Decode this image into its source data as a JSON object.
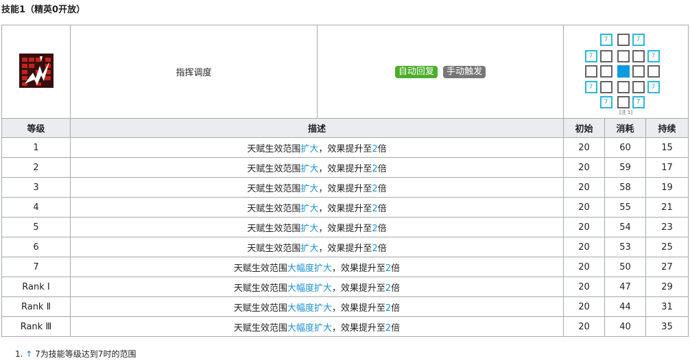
{
  "section_title": "技能1（精英0开放）",
  "skill": {
    "name": "指挥调度",
    "tags": [
      "自动回复",
      "手动触发"
    ],
    "range_note": "[注 1]",
    "range_ext_label": "7"
  },
  "columns": {
    "level": "等级",
    "desc": "描述",
    "init": "初始",
    "cost": "消耗",
    "duration": "持续"
  },
  "rows": [
    {
      "level": "1",
      "desc_a": "天赋生效范围",
      "desc_hl": "扩大",
      "desc_b": "，效果提升至",
      "desc_num": "2",
      "desc_c": "倍",
      "init": "20",
      "cost": "60",
      "duration": "15"
    },
    {
      "level": "2",
      "desc_a": "天赋生效范围",
      "desc_hl": "扩大",
      "desc_b": "，效果提升至",
      "desc_num": "2",
      "desc_c": "倍",
      "init": "20",
      "cost": "59",
      "duration": "17"
    },
    {
      "level": "3",
      "desc_a": "天赋生效范围",
      "desc_hl": "扩大",
      "desc_b": "，效果提升至",
      "desc_num": "2",
      "desc_c": "倍",
      "init": "20",
      "cost": "58",
      "duration": "19"
    },
    {
      "level": "4",
      "desc_a": "天赋生效范围",
      "desc_hl": "扩大",
      "desc_b": "，效果提升至",
      "desc_num": "2",
      "desc_c": "倍",
      "init": "20",
      "cost": "55",
      "duration": "21"
    },
    {
      "level": "5",
      "desc_a": "天赋生效范围",
      "desc_hl": "扩大",
      "desc_b": "，效果提升至",
      "desc_num": "2",
      "desc_c": "倍",
      "init": "20",
      "cost": "54",
      "duration": "23"
    },
    {
      "level": "6",
      "desc_a": "天赋生效范围",
      "desc_hl": "扩大",
      "desc_b": "，效果提升至",
      "desc_num": "2",
      "desc_c": "倍",
      "init": "20",
      "cost": "53",
      "duration": "25"
    },
    {
      "level": "7",
      "desc_a": "天赋生效范围",
      "desc_hl": "大幅度扩大",
      "desc_b": "，效果提升至",
      "desc_num": "2",
      "desc_c": "倍",
      "init": "20",
      "cost": "50",
      "duration": "27"
    },
    {
      "level": "Rank Ⅰ",
      "desc_a": "天赋生效范围",
      "desc_hl": "大幅度扩大",
      "desc_b": "，效果提升至",
      "desc_num": "2",
      "desc_c": "倍",
      "init": "20",
      "cost": "47",
      "duration": "29"
    },
    {
      "level": "Rank Ⅱ",
      "desc_a": "天赋生效范围",
      "desc_hl": "大幅度扩大",
      "desc_b": "，效果提升至",
      "desc_num": "2",
      "desc_c": "倍",
      "init": "20",
      "cost": "44",
      "duration": "31"
    },
    {
      "level": "Rank Ⅲ",
      "desc_a": "天赋生效范围",
      "desc_hl": "大幅度扩大",
      "desc_b": "，效果提升至",
      "desc_num": "2",
      "desc_c": "倍",
      "init": "20",
      "cost": "40",
      "duration": "35"
    }
  ],
  "footnote": {
    "number": "1.",
    "arrow": "↑",
    "text": "7为技能等级达到7时的范围"
  },
  "colors": {
    "highlight": "#1a8fd6",
    "tag_auto": "#4cae2c",
    "tag_manual": "#777777",
    "range_self": "#0d9be0",
    "range_ext": "#27b6e0"
  }
}
